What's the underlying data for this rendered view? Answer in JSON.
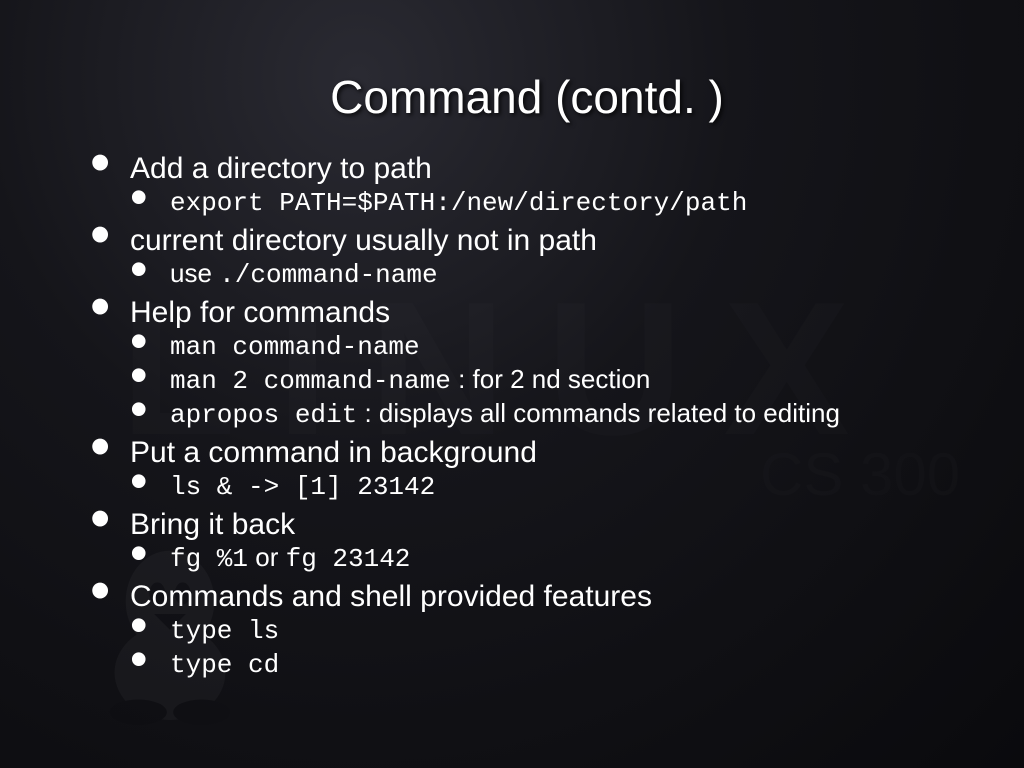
{
  "title": "Command (contd. )",
  "watermark": "LINUX",
  "watermark_sub": "CS 300",
  "items": [
    {
      "text": "Add a directory to path",
      "subs": [
        {
          "code": "export PATH=$PATH:/new/directory/path"
        }
      ]
    },
    {
      "text": "current directory usually not in path",
      "subs": [
        {
          "pre": "use ",
          "code": "./command-name"
        }
      ]
    },
    {
      "text": "Help for commands",
      "subs": [
        {
          "code": "man command-name"
        },
        {
          "code": "man 2 command-name",
          "post": " : for 2 nd section"
        },
        {
          "code": "apropos edit",
          "post": " : displays all commands related to editing"
        }
      ]
    },
    {
      "text": "Put a command in background",
      "subs": [
        {
          "code": "ls &   ->   [1] 23142"
        }
      ]
    },
    {
      "text": "Bring it back",
      "subs": [
        {
          "code": "fg %1",
          "mid": " or ",
          "code2": "fg 23142"
        }
      ]
    },
    {
      "text": "Commands and shell provided features",
      "subs": [
        {
          "code": "type ls"
        },
        {
          "code": "type cd"
        }
      ]
    }
  ]
}
